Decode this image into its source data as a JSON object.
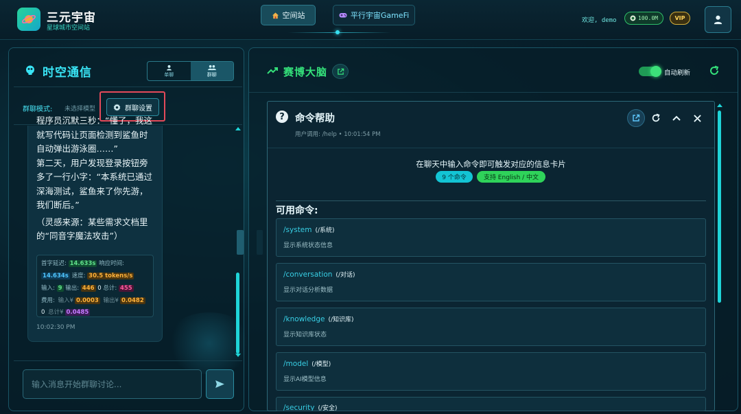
{
  "header": {
    "brand_title": "三元宇宙",
    "brand_subtitle": "星球城市空间站",
    "nav": [
      {
        "label": "空间站",
        "icon": "home-icon"
      },
      {
        "label": "平行宇宙GameFi",
        "icon": "gamepad-icon"
      }
    ],
    "welcome": "欢迎, demo",
    "coins": "100.0M",
    "vip": "VIP"
  },
  "left_panel": {
    "title": "时空通信",
    "tabs": [
      {
        "label": "单聊",
        "icon": "user-icon"
      },
      {
        "label": "群聊",
        "icon": "group-icon",
        "selected": true
      }
    ],
    "mode_label": "群聊模式:",
    "mode_value": "未选择模型",
    "group_settings_label": "群聊设置",
    "message": {
      "lines": [
        "程序员沉默三秒：“懂了，我这",
        "就写代码让页面检测到鲨鱼时",
        "自动弹出游泳圈……”",
        "第二天，用户发现登录按钮旁",
        "多了一行小字：“本系统已通过",
        "深海测试，鲨鱼来了你先游，",
        "我们断后。”",
        "（灵感来源：某些需求文档里",
        "的“同音字魔法攻击”）"
      ],
      "stats": {
        "first_token_label": "首字延迟:",
        "first_token": "14.633s",
        "response_label": "响应时间:",
        "response": "14.634s",
        "speed_label": "速度:",
        "speed": "30.5 tokens/s",
        "input_label": "输入:",
        "input": "9",
        "output_label": "输出:",
        "output": "446",
        "total_prefix": "0",
        "total_label": "总计:",
        "total": "455",
        "cost_label": "费用:",
        "cost_in_label": "输入¥",
        "cost_in": "0.0003",
        "cost_out_label": "输出¥",
        "cost_out": "0.0482",
        "cost_total_prefix": "0",
        "cost_total_label": "总计¥",
        "cost_total": "0.0485"
      },
      "time": "10:02:30 PM"
    },
    "input_placeholder": "输入消息开始群聊讨论..."
  },
  "right_panel": {
    "title": "赛博大脑",
    "auto_refresh_label": "自动刷新",
    "auto_refresh_on": true,
    "card": {
      "title": "命令帮助",
      "subtitle": "用户调用: /help • 10:01:54 PM",
      "intro": "在聊天中输入命令即可触发对应的信息卡片",
      "tags": [
        "9 个命令",
        "支持 English / 中文"
      ],
      "commands_title": "可用命令:",
      "commands": [
        {
          "name": "/system",
          "alias": "(/系统)",
          "desc": "显示系统状态信息"
        },
        {
          "name": "/conversation",
          "alias": "(/对话)",
          "desc": "显示对话分析数据"
        },
        {
          "name": "/knowledge",
          "alias": "(/知识库)",
          "desc": "显示知识库状态"
        },
        {
          "name": "/model",
          "alias": "(/模型)",
          "desc": "显示AI模型信息"
        },
        {
          "name": "/security",
          "alias": "(/安全)",
          "desc": ""
        }
      ]
    }
  },
  "colors": {
    "accent_cyan": "#39e4f5",
    "accent_green": "#34e07a",
    "highlight_red": "#e44a5a"
  }
}
